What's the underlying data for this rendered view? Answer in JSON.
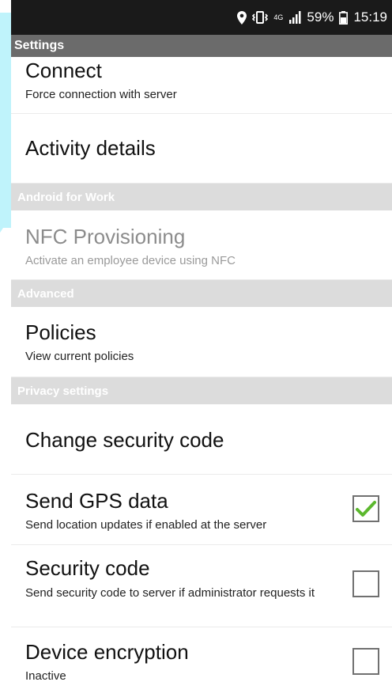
{
  "status_bar": {
    "network_small": "4G",
    "battery_percent": "59%",
    "time": "15:19"
  },
  "app_bar": {
    "title": "Settings"
  },
  "items": {
    "connect": {
      "title": "Connect",
      "summary": "Force connection with server"
    },
    "activity_details": {
      "title": "Activity details"
    },
    "nfc_provisioning": {
      "title": "NFC Provisioning",
      "summary": "Activate an employee device using NFC"
    },
    "policies": {
      "title": "Policies",
      "summary": "View current policies"
    },
    "change_security_code": {
      "title": "Change security code"
    },
    "send_gps_data": {
      "title": "Send GPS data",
      "summary": "Send location updates if enabled at the server",
      "checked": true
    },
    "security_code": {
      "title": "Security code",
      "summary": "Send security code to server if administrator requests it",
      "checked": false
    },
    "device_encryption": {
      "title": "Device encryption",
      "summary": "Inactive",
      "checked": false
    }
  },
  "sections": {
    "android_for_work": "Android for Work",
    "advanced": "Advanced",
    "privacy_settings": "Privacy settings"
  },
  "colors": {
    "status_bar_bg": "#1a1a1a",
    "app_bar_bg": "#6b6b6b",
    "section_bg": "#dcdcdc",
    "check_green": "#5cb82e",
    "left_accent": "#bff3fb"
  },
  "icons": [
    "location-icon",
    "vibrate-icon",
    "signal-icon",
    "battery-icon",
    "check-icon"
  ]
}
